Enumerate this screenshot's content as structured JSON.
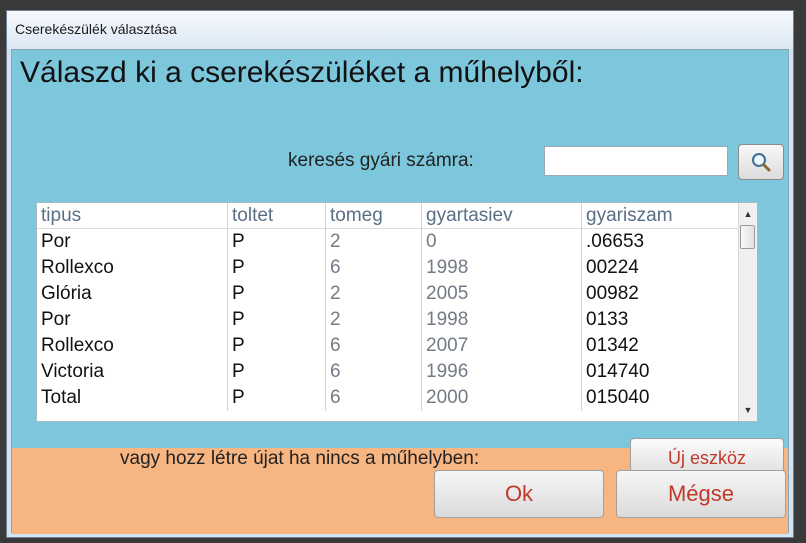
{
  "window": {
    "title": "Cserekészülék választása"
  },
  "heading": "Válaszd ki a cserekészüléket a műhelyből:",
  "search": {
    "label": "keresés gyári számra:",
    "value": "",
    "placeholder": ""
  },
  "table": {
    "columns": [
      "tipus",
      "toltet",
      "tomeg",
      "gyartasiev",
      "gyariszam"
    ],
    "rows": [
      [
        "Por",
        "P",
        "2",
        "0",
        ".06653"
      ],
      [
        "Rollexco",
        "P",
        "6",
        "1998",
        "00224"
      ],
      [
        "Glória",
        "P",
        "2",
        "2005",
        "00982"
      ],
      [
        "Por",
        "P",
        "2",
        "1998",
        "0133"
      ],
      [
        "Rollexco",
        "P",
        "6",
        "2007",
        "01342"
      ],
      [
        "Victoria",
        "P",
        "6",
        "1996",
        "014740"
      ],
      [
        "Total",
        "P",
        "6",
        "2000",
        "015040"
      ]
    ]
  },
  "create": {
    "label": "vagy hozz létre újat ha nincs a műhelyben:",
    "button": "Új eszköz"
  },
  "footer": {
    "ok": "Ok",
    "cancel": "Mégse"
  },
  "colors": {
    "client_bg": "#7dc7dd",
    "footer_bg": "#f7b582",
    "button_text": "#c0392b"
  }
}
